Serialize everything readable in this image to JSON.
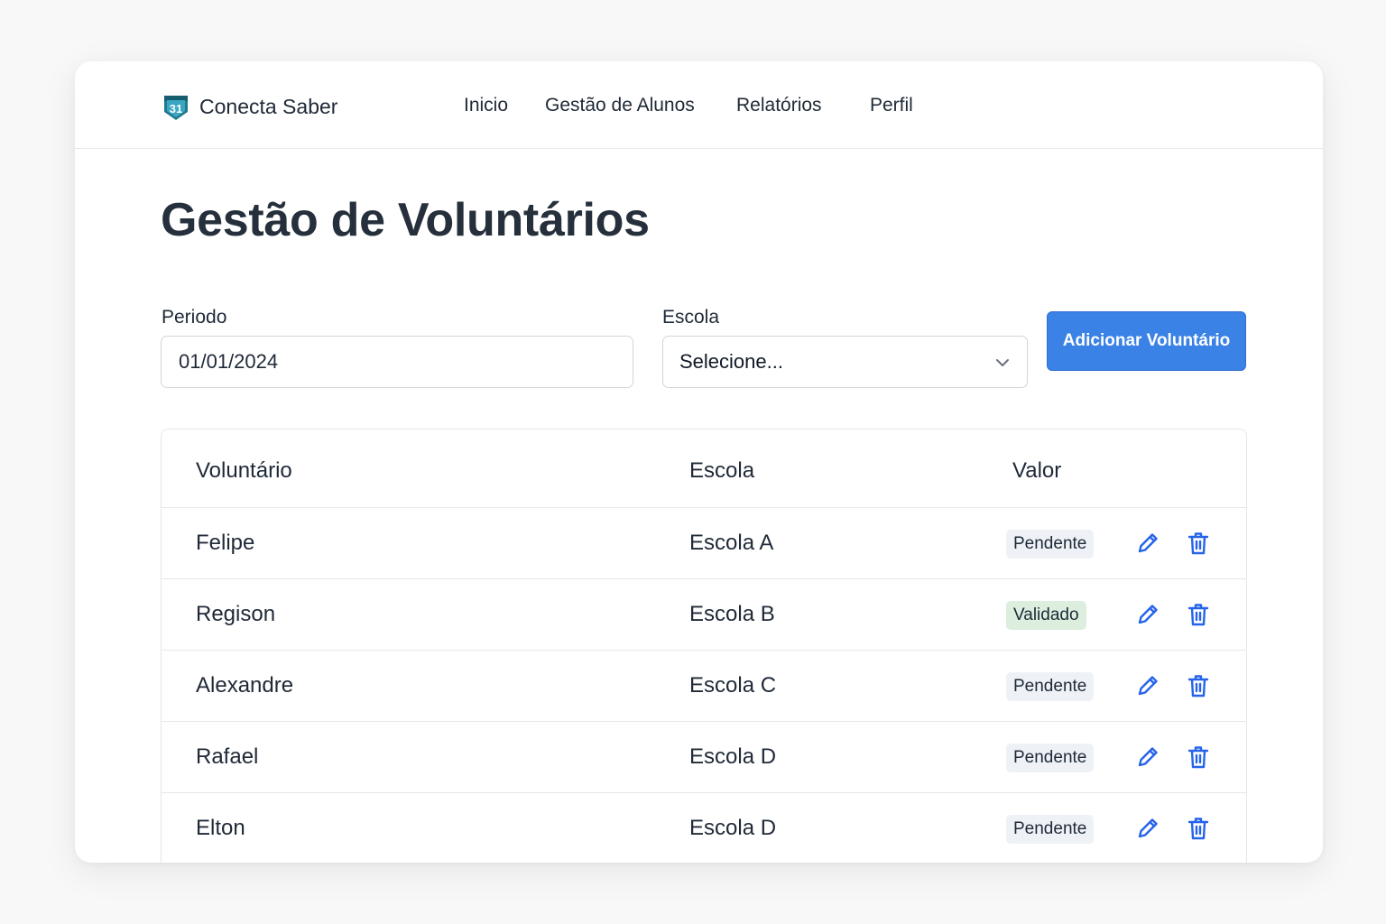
{
  "app": {
    "logo_text": "31",
    "name": "Conecta Saber"
  },
  "nav": [
    "Inicio",
    "Gestão de Alunos",
    "Relatórios",
    "Perfil"
  ],
  "page_title": "Gestão de Voluntários",
  "filters": {
    "period_label": "Periodo",
    "period_value": "01/01/2024",
    "school_label": "Escola",
    "school_value": "Selecione..."
  },
  "add_button": "Adicionar Voluntário",
  "table": {
    "columns": [
      "Voluntário",
      "Escola",
      "Valor"
    ],
    "rows": [
      {
        "name": "Felipe",
        "school": "Escola A",
        "status": "Pendente"
      },
      {
        "name": "Regison",
        "school": "Escola B",
        "status": "Validado"
      },
      {
        "name": "Alexandre",
        "school": "Escola C",
        "status": "Pendente"
      },
      {
        "name": "Rafael",
        "school": "Escola D",
        "status": "Pendente"
      },
      {
        "name": "Elton",
        "school": "Escola D",
        "status": "Pendente"
      }
    ]
  },
  "icons": {
    "logo": "calendar-shield-icon",
    "edit": "pencil-icon",
    "delete": "trash-icon",
    "dropdown": "chevron-down-icon"
  },
  "colors": {
    "primary": "#3b82e6",
    "icon_blue": "#2563eb",
    "pending_badge": "#eef2f7",
    "validated_badge": "#dcefdf"
  }
}
